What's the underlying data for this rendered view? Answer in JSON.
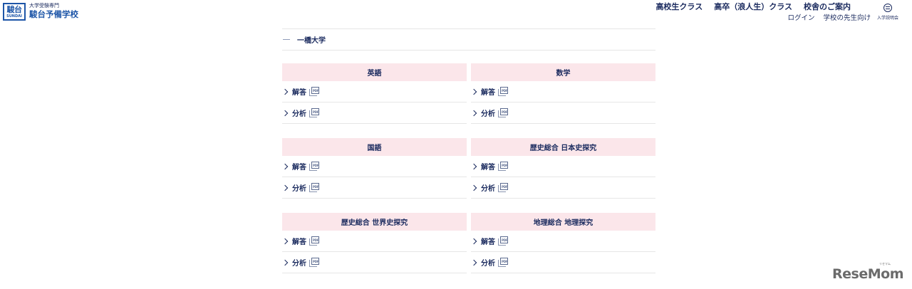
{
  "header": {
    "logo_kanji": "駿台",
    "logo_en": "SUNDAI",
    "logo_sub": "大学受験専門",
    "logo_main": "駿台予備学校",
    "nav_primary": [
      "高校生クラス",
      "高卒（浪人生）クラス",
      "校舎のご案内"
    ],
    "nav_secondary": [
      "ログイン",
      "学校の先生向け"
    ],
    "menu_label": "入学説明会"
  },
  "university": {
    "name": "一橋大学"
  },
  "subjects": [
    {
      "title": "英語",
      "links": [
        "解答",
        "分析"
      ]
    },
    {
      "title": "数学",
      "links": [
        "解答",
        "分析"
      ]
    },
    {
      "title": "国語",
      "links": [
        "解答",
        "分析"
      ]
    },
    {
      "title": "歴史総合 日本史探究",
      "links": [
        "解答",
        "分析"
      ]
    },
    {
      "title": "歴史総合 世界史探究",
      "links": [
        "解答",
        "分析"
      ]
    },
    {
      "title": "地理総合 地理探究",
      "links": [
        "解答",
        "分析"
      ]
    }
  ],
  "icons": {
    "link_chevron": "chevron-right-icon",
    "file_icon": "pdf-icon"
  },
  "colors": {
    "navy": "#1a2a5e",
    "brand_blue": "#1e56a8",
    "subject_header_bg": "#fbe6ea",
    "divider": "#e6e6e6"
  },
  "watermark": {
    "text": "ReseMom",
    "small": "リセマム"
  }
}
